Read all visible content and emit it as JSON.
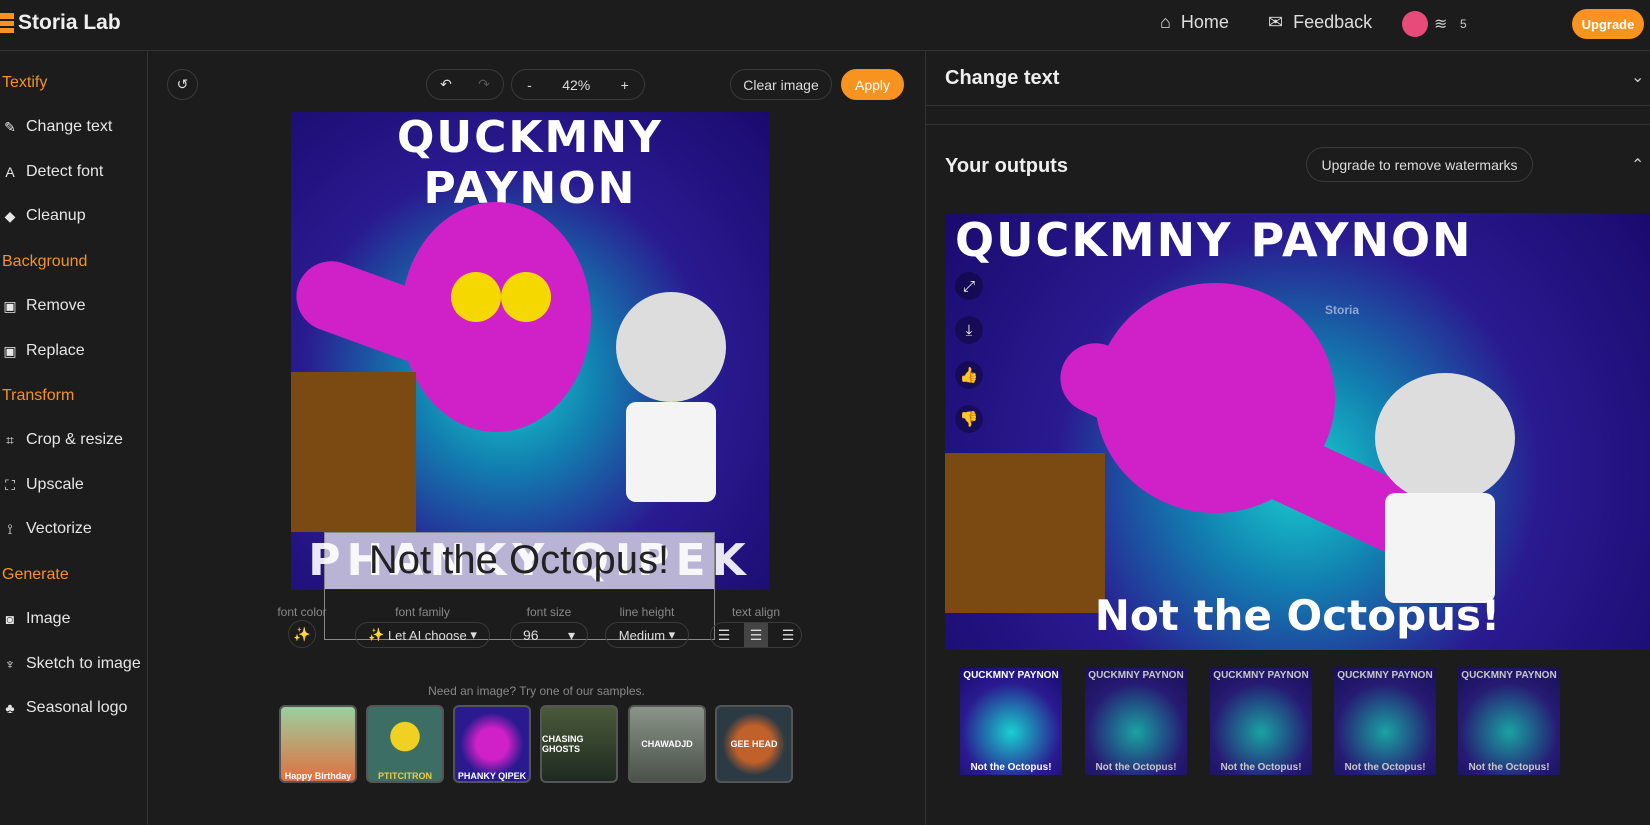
{
  "header": {
    "brand": "Storia Lab",
    "home": "Home",
    "feedback": "Feedback",
    "credits": "5",
    "upgrade": "Upgrade"
  },
  "sidebar": {
    "sections": [
      {
        "title": "Textify",
        "items": [
          "Change text",
          "Detect font",
          "Cleanup"
        ]
      },
      {
        "title": "Background",
        "items": [
          "Remove",
          "Replace"
        ]
      },
      {
        "title": "Transform",
        "items": [
          "Crop & resize",
          "Upscale",
          "Vectorize"
        ]
      },
      {
        "title": "Generate",
        "items": [
          "Image",
          "Sketch to image",
          "Seasonal logo"
        ]
      }
    ]
  },
  "toolbar": {
    "zoom": "42%",
    "minus": "-",
    "plus": "+",
    "clear": "Clear image",
    "apply": "Apply"
  },
  "canvas": {
    "image_title": "QUCKMNY PAYNON",
    "overlay_text": "Not the Octopus!",
    "bg_text": "PHANKY QIPEK"
  },
  "controls": {
    "font_color_label": "font color",
    "font_family_label": "font family",
    "font_family": "Let AI choose",
    "font_size_label": "font size",
    "font_size": "96",
    "line_height_label": "line height",
    "line_height": "Medium",
    "text_align_label": "text align"
  },
  "samples": {
    "prompt": "Need an image? Try one of our samples.",
    "items": [
      "Happy Birthday",
      "PTITCITRON",
      "PHANKY QIPEK",
      "CHASING GHOSTS",
      "CHAWADJD",
      "GEE HEAD"
    ]
  },
  "right": {
    "change_text": "Change text",
    "outputs": "Your outputs",
    "remove_watermarks": "Upgrade to remove watermarks",
    "output_title": "QUCKMNY PAYNON",
    "output_text": "Not the Octopus!",
    "watermark": "Storia",
    "thumbs": [
      {
        "top": "QUCKMNY PAYNON",
        "bottom": "Not the Octopus!"
      },
      {
        "top": "QUCKMNY PAYNON",
        "bottom": "Not the Octopus!"
      },
      {
        "top": "QUCKMNY PAYNON",
        "bottom": "Not the Octopus!"
      },
      {
        "top": "QUCKMNY PAYNON",
        "bottom": "Not the Octopus!"
      },
      {
        "top": "QUCKMNY PAYNON",
        "bottom": "Not the Octopus!"
      }
    ]
  },
  "colors": {
    "accent": "#f7931e",
    "bg": "#1c1c1c"
  }
}
